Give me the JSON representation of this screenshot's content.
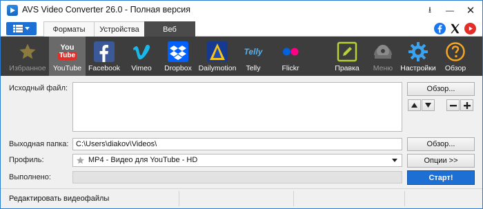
{
  "window": {
    "title": "AVS Video Converter 26.0 - Полная версия",
    "buttons": {
      "download": "⭳",
      "minimize": "—",
      "close": "✕"
    }
  },
  "tabs": {
    "menu_icon": "menu-list-icon",
    "items": [
      {
        "label": "Форматы",
        "selected": false
      },
      {
        "label": "Устройства",
        "selected": false
      },
      {
        "label": "Веб",
        "selected": true
      }
    ],
    "social": [
      "facebook-icon",
      "x-icon",
      "youtube-icon"
    ]
  },
  "toolbar": {
    "items": [
      {
        "label": "Избранное",
        "icon": "star-icon",
        "enabled": false,
        "selected": false
      },
      {
        "label": "YouTube",
        "icon": "youtube-icon",
        "enabled": true,
        "selected": true
      },
      {
        "label": "Facebook",
        "icon": "facebook-icon",
        "enabled": true,
        "selected": false
      },
      {
        "label": "Vimeo",
        "icon": "vimeo-icon",
        "enabled": true,
        "selected": false
      },
      {
        "label": "Dropbox",
        "icon": "dropbox-icon",
        "enabled": true,
        "selected": false
      },
      {
        "label": "Dailymotion",
        "icon": "dailymotion-icon",
        "enabled": true,
        "selected": false
      },
      {
        "label": "Telly",
        "icon": "telly-icon",
        "enabled": true,
        "selected": false
      },
      {
        "label": "Flickr",
        "icon": "flickr-icon",
        "enabled": true,
        "selected": false
      },
      {
        "label": "Правка",
        "icon": "edit-icon",
        "enabled": true,
        "selected": false
      },
      {
        "label": "Меню",
        "icon": "disc-menu-icon",
        "enabled": false,
        "selected": false
      },
      {
        "label": "Настройки",
        "icon": "gear-icon",
        "enabled": true,
        "selected": false
      },
      {
        "label": "Обзор",
        "icon": "help-icon",
        "enabled": true,
        "selected": false
      }
    ],
    "youtube_logo_text": "You",
    "youtube_logo_tube": "Tube",
    "telly_logo_text": "Telly"
  },
  "main": {
    "source_label": "Исходный файл:",
    "output_label": "Выходная папка:",
    "output_value": "C:\\Users\\diakov\\Videos\\",
    "profile_label": "Профиль:",
    "profile_value": "MP4 - Видео для YouTube - HD",
    "progress_label": "Выполнено:",
    "progress": 0,
    "browse_source": "Обзор...",
    "browse_output": "Обзор...",
    "options": "Опции >>",
    "start": "Старт!"
  },
  "status": {
    "text": "Редактировать видеофайлы"
  },
  "colors": {
    "accent": "#1e6fd3",
    "toolbar_bg": "#3d3d3d"
  }
}
